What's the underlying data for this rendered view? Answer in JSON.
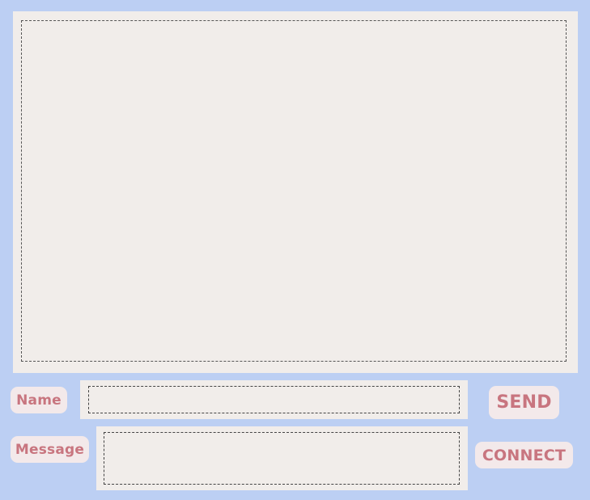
{
  "chat": {
    "log_text": ""
  },
  "name_field": {
    "label": "Name",
    "value": "",
    "placeholder": ""
  },
  "message_field": {
    "label": "Message",
    "value": "",
    "placeholder": ""
  },
  "buttons": {
    "send_label": "SEND",
    "connect_label": "CONNECT"
  },
  "colors": {
    "background": "#bccff3",
    "panel": "#f1edea",
    "label_bg": "#f3e9ea",
    "label_text": "#c8757f"
  }
}
